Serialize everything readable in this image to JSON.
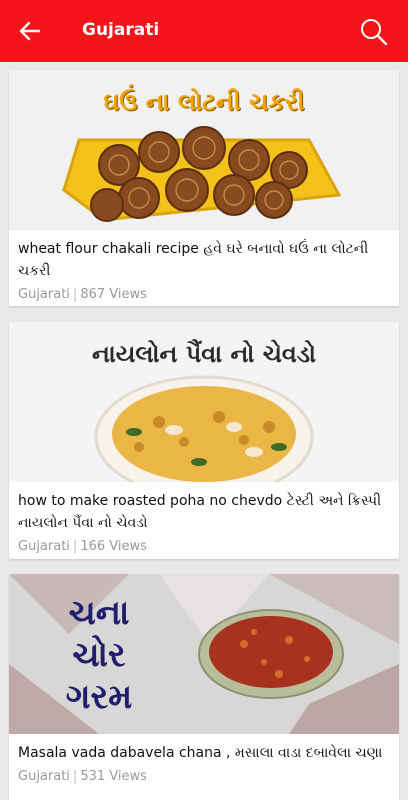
{
  "appbar": {
    "title": "Gujarati",
    "back_icon": "arrow-left-icon",
    "search_icon": "search-icon",
    "background": "#f5141a"
  },
  "videos": [
    {
      "thumbnail_caption": "ઘઉં ના લોટની ચકરી",
      "title": "wheat flour chakali recipe  હવે ઘરે બનાવો ઘઉં ના લોટની ચકરી",
      "channel": "Gujarati",
      "separator": "|",
      "views": "867 Views"
    },
    {
      "thumbnail_caption": "નાયલોન પૈંવા નો ચેવડો",
      "title": "how to make  roasted poha no chevdo ટેસ્ટી અને ક્રિસ્પી નાયલોન પૈંવા નો ચેવડો",
      "channel": "Gujarati",
      "separator": "|",
      "views": "166 Views"
    },
    {
      "thumbnail_caption_lines": [
        "ચના",
        "ચોર",
        "ગરમ"
      ],
      "title": "Masala vada dabavela chana , મસાલા વાડા દબાવેલા ચણા",
      "channel": "Gujarati",
      "separator": "|",
      "views": "531 Views"
    }
  ]
}
